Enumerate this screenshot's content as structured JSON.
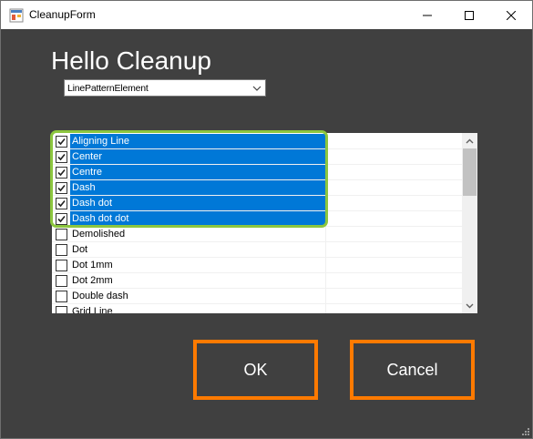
{
  "window": {
    "title": "CleanupForm",
    "buttons": {
      "minimize": "minimize-icon",
      "maximize": "maximize-icon",
      "close": "close-icon"
    }
  },
  "heading": "Hello Cleanup",
  "combo": {
    "value": "LinePatternElement"
  },
  "list": {
    "items": [
      {
        "label": "Aligning Line",
        "checked": true,
        "selected": true
      },
      {
        "label": "Center",
        "checked": true,
        "selected": true
      },
      {
        "label": "Centre",
        "checked": true,
        "selected": true
      },
      {
        "label": "Dash",
        "checked": true,
        "selected": true
      },
      {
        "label": "Dash dot",
        "checked": true,
        "selected": true
      },
      {
        "label": "Dash dot dot",
        "checked": true,
        "selected": true
      },
      {
        "label": "Demolished",
        "checked": false,
        "selected": false
      },
      {
        "label": "Dot",
        "checked": false,
        "selected": false
      },
      {
        "label": "Dot  1mm",
        "checked": false,
        "selected": false
      },
      {
        "label": "Dot  2mm",
        "checked": false,
        "selected": false
      },
      {
        "label": "Double dash",
        "checked": false,
        "selected": false
      },
      {
        "label": "Grid Line",
        "checked": false,
        "selected": false
      }
    ]
  },
  "buttons": {
    "ok": "OK",
    "cancel": "Cancel"
  },
  "colors": {
    "background": "#404040",
    "selection": "#0078d7",
    "highlight_green": "#8cc63f",
    "highlight_orange": "#ff7a00"
  }
}
